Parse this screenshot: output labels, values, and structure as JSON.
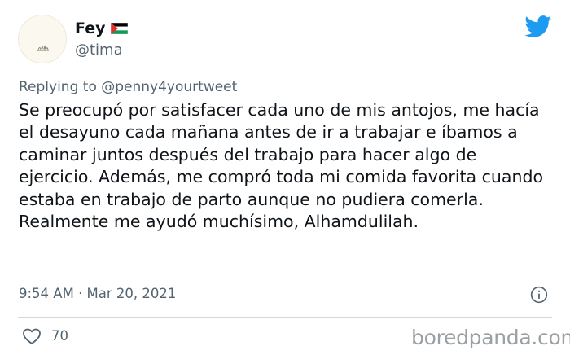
{
  "author": {
    "display_name": "Fey",
    "handle": "@tima",
    "flag_icon": "palestine-flag-icon",
    "avatar_icon": "avatar-image"
  },
  "brand": {
    "icon": "twitter-bird-icon",
    "color": "#1d9bf0"
  },
  "reply": {
    "prefix": "Replying to",
    "mention": "@penny4yourtweet"
  },
  "tweet": {
    "text": "Se preocupó por satisfacer cada uno de mis antojos, me hacía el desayuno cada mañana antes de ir a trabajar e íbamos a caminar juntos después del trabajo para hacer algo de ejercicio. Además, me compró toda mi comida favorita cuando estaba en trabajo de parto aunque no pudiera comerla. Realmente me ayudó muchísimo, Alhamdulilah."
  },
  "meta": {
    "timestamp": "9:54 AM · Mar 20, 2021",
    "info_icon": "info-icon"
  },
  "actions": {
    "like_icon": "heart-icon",
    "like_count": "70"
  },
  "watermark": {
    "text": "boredpanda.com"
  }
}
